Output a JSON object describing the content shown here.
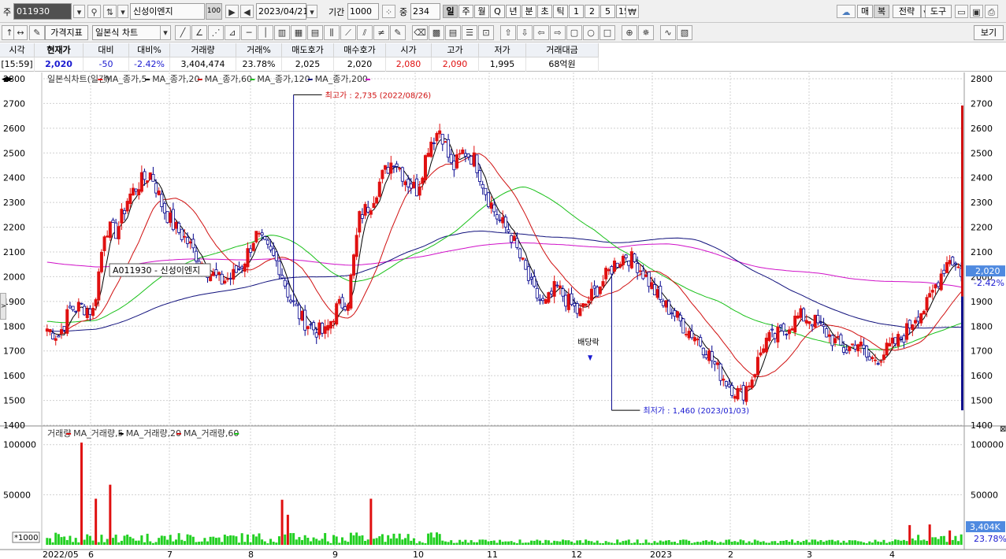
{
  "toolbar1": {
    "market_label": "주",
    "stock_code": "011930",
    "stock_name": "신성이엔지",
    "name_badge": "100",
    "date": "2023/04/21",
    "period_label": "기간",
    "period_value": "1000",
    "zoom_label": "중",
    "zoom_value": "234",
    "period_buttons": [
      "일",
      "주",
      "월",
      "Q",
      "년",
      "분",
      "초",
      "틱",
      "1",
      "2",
      "5",
      "15"
    ],
    "right_buttons": [
      "매",
      "복",
      "전략",
      "도구"
    ]
  },
  "toolbar2": {
    "price_indicator_button": "가격지표",
    "chart_type_select": "일본식 차트",
    "view_button": "보기"
  },
  "quote": {
    "headers": [
      "시각",
      "현재가",
      "대비",
      "대비%",
      "거래량",
      "거래%",
      "매도호가",
      "매수호가",
      "시가",
      "고가",
      "저가",
      "거래대금"
    ],
    "values": [
      "[15:59]",
      "2,020",
      "-50",
      "-2.42%",
      "3,404,474",
      "23.78%",
      "2,025",
      "2,020",
      "2,080",
      "2,090",
      "1,995",
      "68억원"
    ]
  },
  "colors": {
    "up": "#e01010",
    "down": "#00008c",
    "ma5": "#000000",
    "ma20": "#d01010",
    "ma60": "#18c018",
    "ma120": "#10107c",
    "ma200": "#d010c8",
    "vol_green": "#22d022"
  },
  "price_panel": {
    "legend": [
      {
        "text": "일본식차트(일간)",
        "color": "#e01010"
      },
      {
        "text": "MA_종가,5",
        "color": "#000000"
      },
      {
        "text": "MA_종가,20",
        "color": "#d01010"
      },
      {
        "text": "MA_종가,60",
        "color": "#18c018"
      },
      {
        "text": "MA_종가,120",
        "color": "#10107c"
      },
      {
        "text": "MA_종가,200",
        "color": "#d010c8"
      }
    ],
    "y_ticks": [
      2800,
      2700,
      2600,
      2500,
      2400,
      2300,
      2200,
      2100,
      2000,
      1900,
      1800,
      1700,
      1600,
      1500,
      1400
    ],
    "high_annotation": "최고가 : 2,735 (2022/08/26)",
    "low_annotation": "최저가 : 1,460 (2023/01/03)",
    "dividend_label": "배당락",
    "stock_tooltip": "A011930 - 신성이엔지",
    "current_price_tag": "2,020",
    "current_change_tag": "-2.42%"
  },
  "volume_panel": {
    "legend": [
      {
        "text": "거래량",
        "color": "#e01010"
      },
      {
        "text": "MA_거래량,5",
        "color": "#000000"
      },
      {
        "text": "MA_거래량,20",
        "color": "#d01010"
      },
      {
        "text": "MA_거래량,60",
        "color": "#18c018"
      }
    ],
    "y_ticks": [
      100000,
      50000
    ],
    "unit_label": "*1000",
    "current_volume_tag": "3,404K",
    "current_ratio_tag": "23.78%"
  },
  "x_axis_labels": [
    "2022/05",
    "6",
    "7",
    "8",
    "9",
    "10",
    "11",
    "12",
    "2023",
    "2",
    "3",
    "4"
  ],
  "chart_data": {
    "type": "candlestick",
    "title": "일본식차트(일간)",
    "ylim": [
      1400,
      2800
    ],
    "months": [
      "2022/05",
      "6",
      "7",
      "8",
      "9",
      "10",
      "11",
      "12",
      "2023",
      "2",
      "3",
      "4"
    ],
    "close_path": [
      [
        "2022/05",
        1790
      ],
      [
        "2022/05",
        1760
      ],
      [
        "2022/05",
        1870
      ],
      [
        "2022/05",
        1880
      ],
      [
        "2022/05",
        1860
      ],
      [
        "2022/05",
        2200
      ],
      [
        "2022/05",
        2180
      ],
      [
        "6",
        2320
      ],
      [
        "6",
        2380
      ],
      [
        "6",
        2420
      ],
      [
        "6",
        2280
      ],
      [
        "6",
        2200
      ],
      [
        "6",
        2150
      ],
      [
        "6",
        2080
      ],
      [
        "6",
        2020
      ],
      [
        "6",
        1980
      ],
      [
        "7",
        2000
      ],
      [
        "7",
        2060
      ],
      [
        "7",
        2170
      ],
      [
        "7",
        2110
      ],
      [
        "7",
        2050
      ],
      [
        "7",
        1910
      ],
      [
        "7",
        1830
      ],
      [
        "7",
        1790
      ],
      [
        "7",
        1770
      ],
      [
        "8",
        1870
      ],
      [
        "8",
        1910
      ],
      [
        "8",
        2240
      ],
      [
        "8",
        2300
      ],
      [
        "8",
        2410
      ],
      [
        "8",
        2480
      ],
      [
        "8",
        2390
      ],
      [
        "8",
        2350
      ],
      [
        "9",
        2540
      ],
      [
        "9",
        2600
      ],
      [
        "9",
        2430
      ],
      [
        "9",
        2510
      ],
      [
        "9",
        2470
      ],
      [
        "9",
        2330
      ],
      [
        "9",
        2230
      ],
      [
        "9",
        2180
      ],
      [
        "10",
        2060
      ],
      [
        "10",
        1940
      ],
      [
        "10",
        1880
      ],
      [
        "10",
        1960
      ],
      [
        "10",
        1900
      ],
      [
        "10",
        1850
      ],
      [
        "11",
        1920
      ],
      [
        "11",
        1980
      ],
      [
        "11",
        2050
      ],
      [
        "11",
        2090
      ],
      [
        "11",
        2050
      ],
      [
        "11",
        1980
      ],
      [
        "11",
        1900
      ],
      [
        "12",
        1860
      ],
      [
        "12",
        1800
      ],
      [
        "12",
        1760
      ],
      [
        "12",
        1700
      ],
      [
        "12",
        1620
      ],
      [
        "12",
        1560
      ],
      [
        "2023",
        1520
      ],
      [
        "2023",
        1600
      ],
      [
        "2023",
        1740
      ],
      [
        "2023",
        1760
      ],
      [
        "2023",
        1800
      ],
      [
        "2",
        1840
      ],
      [
        "2",
        1830
      ],
      [
        "2",
        1790
      ],
      [
        "2",
        1740
      ],
      [
        "3",
        1700
      ],
      [
        "3",
        1740
      ],
      [
        "3",
        1660
      ],
      [
        "3",
        1680
      ],
      [
        "3",
        1720
      ],
      [
        "3",
        1760
      ],
      [
        "4",
        1840
      ],
      [
        "4",
        1880
      ],
      [
        "4",
        1990
      ],
      [
        "4",
        2080
      ],
      [
        "4",
        2020
      ]
    ],
    "ma_values_at_right_edge": {
      "MA_종가,5": 2060,
      "MA_종가,20": 1900,
      "MA_종가,60": 1795,
      "MA_종가,120": 1805,
      "MA_종가,200": 1930
    },
    "volume_unit": "*1000",
    "volume_ylim": [
      0,
      110000
    ],
    "volume_peaks": [
      [
        "2022/05",
        102000
      ],
      [
        "6",
        46000
      ],
      [
        "6",
        60000
      ],
      [
        "8",
        45000
      ],
      [
        "8",
        30000
      ],
      [
        "9",
        46000
      ]
    ]
  }
}
